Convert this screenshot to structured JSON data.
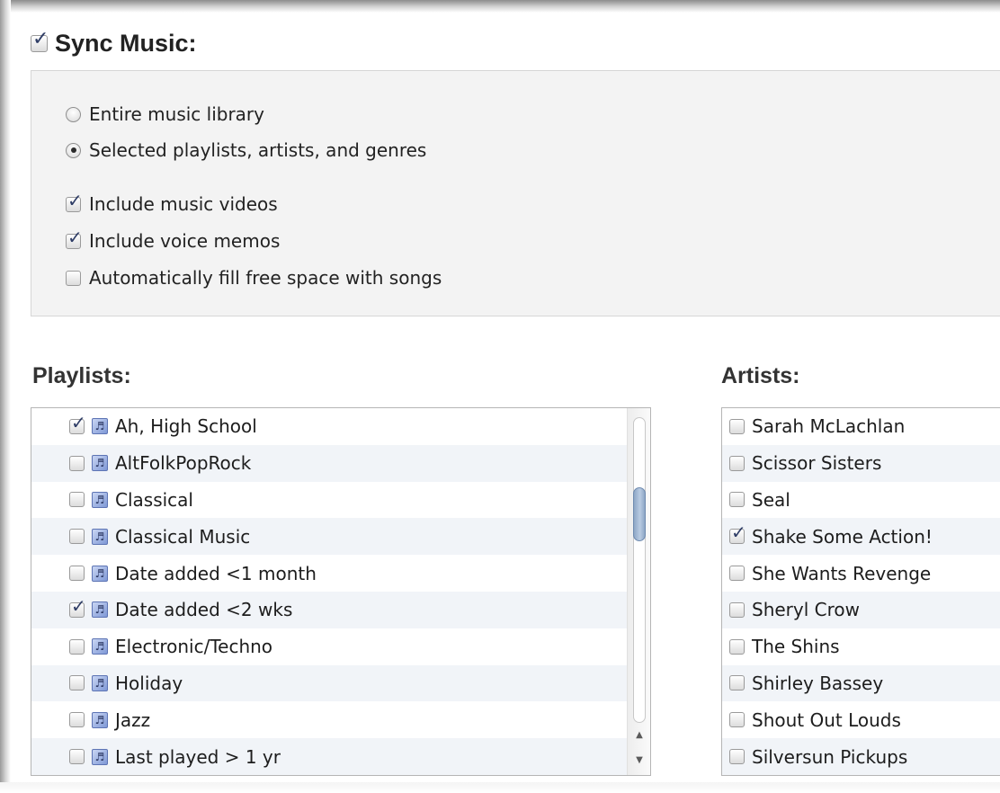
{
  "sync": {
    "title": "Sync Music:",
    "checked": true
  },
  "options": {
    "radios": [
      {
        "label": "Entire music library",
        "selected": false
      },
      {
        "label": "Selected playlists, artists, and genres",
        "selected": true
      }
    ],
    "checkboxes": [
      {
        "label": "Include music videos",
        "checked": true
      },
      {
        "label": "Include voice memos",
        "checked": true
      },
      {
        "label": "Automatically fill free space with songs",
        "checked": false
      }
    ]
  },
  "playlists": {
    "title": "Playlists:",
    "items": [
      {
        "label": "Ah, High School",
        "checked": true
      },
      {
        "label": "AltFolkPopRock",
        "checked": false
      },
      {
        "label": "Classical",
        "checked": false
      },
      {
        "label": "Classical Music",
        "checked": false
      },
      {
        "label": "Date added <1 month",
        "checked": false
      },
      {
        "label": "Date added <2 wks",
        "checked": true
      },
      {
        "label": "Electronic/Techno",
        "checked": false
      },
      {
        "label": "Holiday",
        "checked": false
      },
      {
        "label": "Jazz",
        "checked": false
      },
      {
        "label": "Last played > 1 yr",
        "checked": false
      }
    ]
  },
  "artists": {
    "title": "Artists:",
    "items": [
      {
        "label": "Sarah McLachlan",
        "checked": false
      },
      {
        "label": "Scissor Sisters",
        "checked": false
      },
      {
        "label": "Seal",
        "checked": false
      },
      {
        "label": "Shake Some Action!",
        "checked": true
      },
      {
        "label": "She Wants Revenge",
        "checked": false
      },
      {
        "label": "Sheryl Crow",
        "checked": false
      },
      {
        "label": "The Shins",
        "checked": false
      },
      {
        "label": "Shirley Bassey",
        "checked": false
      },
      {
        "label": "Shout Out Louds",
        "checked": false
      },
      {
        "label": "Silversun Pickups",
        "checked": false
      }
    ]
  },
  "icons": {
    "playlist_glyph": "♬",
    "scroll_up": "▲",
    "scroll_down": "▼"
  }
}
